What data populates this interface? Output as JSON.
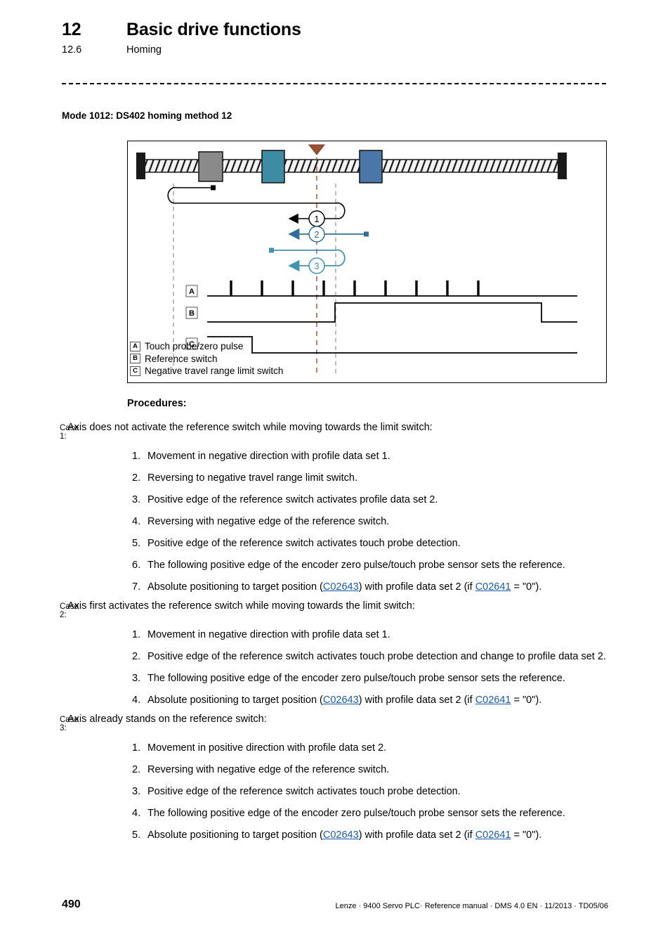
{
  "header": {
    "chapter_number": "12",
    "chapter_title": "Basic drive functions",
    "section_number": "12.6",
    "section_title": "Homing"
  },
  "mode_caption": "Mode 1012: DS402 homing method 12",
  "figure": {
    "legend": [
      {
        "tag": "A",
        "text": "Touch probe/zero pulse"
      },
      {
        "tag": "B",
        "text": "Reference switch"
      },
      {
        "tag": "C",
        "text": "Negative travel range limit switch"
      }
    ],
    "trace_labels": {
      "a": "A",
      "b": "B",
      "c": "C"
    },
    "motion_markers": [
      "1",
      "2",
      "3"
    ],
    "colors": {
      "rail_stop": "#1a1a1a",
      "block_gray": "#8a8a8a",
      "block_teal": "#3d8ca4",
      "block_steel": "#4a77a8",
      "marker_brown": "#9c4f32",
      "arrow_black": "#000000",
      "arrow_steel": "#2f6e96",
      "arrow_teal": "#3f93b5",
      "dashed_gray": "#9a9a9a"
    }
  },
  "procedures": {
    "title": "Procedures:",
    "cases": [
      {
        "label": "Case 1:",
        "intro": "Axis does not activate the reference switch while moving towards the limit switch:",
        "steps": [
          {
            "text": "Movement in negative direction with profile data set 1."
          },
          {
            "text": "Reversing to negative travel range limit switch."
          },
          {
            "text": "Positive edge of the reference switch activates profile data set 2."
          },
          {
            "text": "Reversing with negative edge of the reference switch."
          },
          {
            "text": "Positive edge of the reference switch activates touch probe detection."
          },
          {
            "text": "The following positive edge of the encoder zero pulse/touch probe sensor sets the reference."
          },
          {
            "parts": [
              {
                "t": "Absolute positioning to target position ("
              },
              {
                "link": "C02643"
              },
              {
                "t": ") with profile data set 2 (if "
              },
              {
                "link": "C02641"
              },
              {
                "t": " = \"0\")."
              }
            ]
          }
        ]
      },
      {
        "label": "Case 2:",
        "intro": "Axis first activates the reference switch while moving towards the limit switch:",
        "steps": [
          {
            "text": "Movement in negative direction with profile data set 1."
          },
          {
            "text": "Positive edge of the reference switch activates touch probe detection and change to profile data set 2."
          },
          {
            "text": "The following positive edge of the encoder zero pulse/touch probe sensor sets the reference."
          },
          {
            "parts": [
              {
                "t": "Absolute positioning to target position ("
              },
              {
                "link": "C02643"
              },
              {
                "t": ") with profile data set 2 (if "
              },
              {
                "link": "C02641"
              },
              {
                "t": " = \"0\")."
              }
            ]
          }
        ]
      },
      {
        "label": "Case 3:",
        "intro": "Axis already stands on the reference switch:",
        "steps": [
          {
            "text": "Movement in positive direction with profile data set 2."
          },
          {
            "text": "Reversing with negative edge of the reference switch."
          },
          {
            "text": "Positive edge of the reference switch activates touch probe detection."
          },
          {
            "text": "The following positive edge of the encoder zero pulse/touch probe sensor sets the reference."
          },
          {
            "parts": [
              {
                "t": "Absolute positioning to target position ("
              },
              {
                "link": "C02643"
              },
              {
                "t": ") with profile data set 2 (if "
              },
              {
                "link": "C02641"
              },
              {
                "t": " = \"0\")."
              }
            ]
          }
        ]
      }
    ]
  },
  "footer": {
    "page_number": "490",
    "meta": "Lenze · 9400 Servo PLC· Reference manual · DMS 4.0 EN · 11/2013 · TD05/06"
  }
}
